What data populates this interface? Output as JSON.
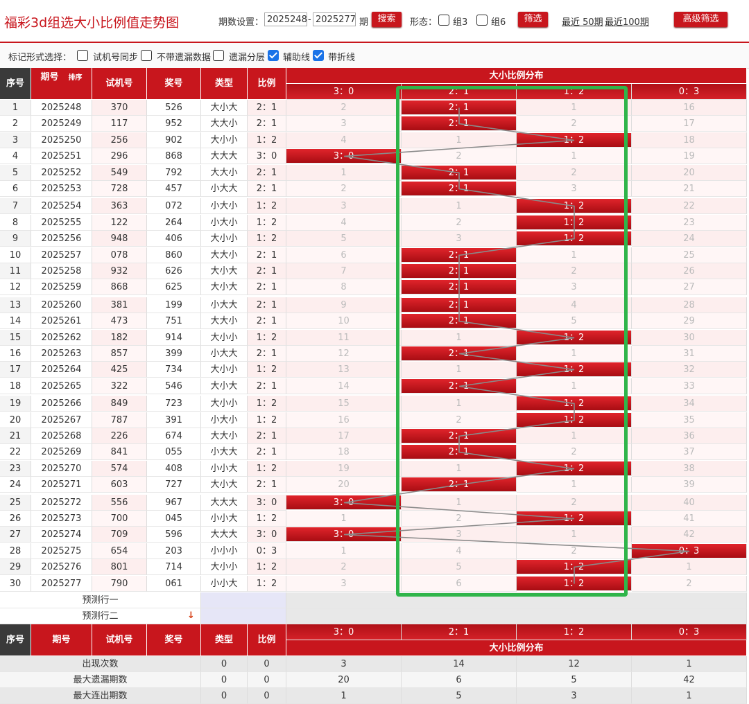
{
  "header": {
    "title": "福彩3d组选大小比例值走势图",
    "period_label": "期数设置：",
    "period_from": "2025248",
    "period_dash": "-",
    "period_to": "2025277",
    "period_unit": "期",
    "search_label": "搜索",
    "form_label": "形态：",
    "group3_label": "组3",
    "group6_label": "组6",
    "filter_label": "筛选",
    "recent50_label": "最近 50期",
    "recent100_label": "最近100期",
    "advanced_label": "高级筛选"
  },
  "mark": {
    "label": "标记形式选择：",
    "options": [
      {
        "label": "试机号同步",
        "checked": false
      },
      {
        "label": "不带遗漏数据",
        "checked": false
      },
      {
        "label": "遗漏分层",
        "checked": false
      },
      {
        "label": "辅助线",
        "checked": true
      },
      {
        "label": "带折线",
        "checked": true
      }
    ]
  },
  "table": {
    "headers": {
      "seq": "序号",
      "period": "期号",
      "sort": "排序",
      "trial": "试机号",
      "draw": "奖号",
      "type": "类型",
      "ratio": "比例",
      "dist": "大小比例分布"
    },
    "dist_cols": [
      "3：0",
      "2：1",
      "1：2",
      "0：3"
    ],
    "rows": [
      {
        "seq": "1",
        "period": "2025248",
        "trial": "370",
        "draw": "526",
        "type": "大小大",
        "ratio": "2：1",
        "hit": 1,
        "miss": [
          "2",
          "",
          "1",
          "16"
        ]
      },
      {
        "seq": "2",
        "period": "2025249",
        "trial": "117",
        "draw": "952",
        "type": "大大小",
        "ratio": "2：1",
        "hit": 1,
        "miss": [
          "3",
          "",
          "2",
          "17"
        ]
      },
      {
        "seq": "3",
        "period": "2025250",
        "trial": "256",
        "draw": "902",
        "type": "大小小",
        "ratio": "1：2",
        "hit": 2,
        "miss": [
          "4",
          "1",
          "",
          "18"
        ]
      },
      {
        "seq": "4",
        "period": "2025251",
        "trial": "296",
        "draw": "868",
        "type": "大大大",
        "ratio": "3：0",
        "hit": 0,
        "miss": [
          "",
          "2",
          "1",
          "19"
        ]
      },
      {
        "seq": "5",
        "period": "2025252",
        "trial": "549",
        "draw": "792",
        "type": "大大小",
        "ratio": "2：1",
        "hit": 1,
        "miss": [
          "1",
          "",
          "2",
          "20"
        ]
      },
      {
        "seq": "6",
        "period": "2025253",
        "trial": "728",
        "draw": "457",
        "type": "小大大",
        "ratio": "2：1",
        "hit": 1,
        "miss": [
          "2",
          "",
          "3",
          "21"
        ]
      },
      {
        "seq": "7",
        "period": "2025254",
        "trial": "363",
        "draw": "072",
        "type": "小大小",
        "ratio": "1：2",
        "hit": 2,
        "miss": [
          "3",
          "1",
          "",
          "22"
        ]
      },
      {
        "seq": "8",
        "period": "2025255",
        "trial": "122",
        "draw": "264",
        "type": "小大小",
        "ratio": "1：2",
        "hit": 2,
        "miss": [
          "4",
          "2",
          "",
          "23"
        ]
      },
      {
        "seq": "9",
        "period": "2025256",
        "trial": "948",
        "draw": "406",
        "type": "大小小",
        "ratio": "1：2",
        "hit": 2,
        "miss": [
          "5",
          "3",
          "",
          "24"
        ]
      },
      {
        "seq": "10",
        "period": "2025257",
        "trial": "078",
        "draw": "860",
        "type": "大大小",
        "ratio": "2：1",
        "hit": 1,
        "miss": [
          "6",
          "",
          "1",
          "25"
        ]
      },
      {
        "seq": "11",
        "period": "2025258",
        "trial": "932",
        "draw": "626",
        "type": "大小大",
        "ratio": "2：1",
        "hit": 1,
        "miss": [
          "7",
          "",
          "2",
          "26"
        ]
      },
      {
        "seq": "12",
        "period": "2025259",
        "trial": "868",
        "draw": "625",
        "type": "大小大",
        "ratio": "2：1",
        "hit": 1,
        "miss": [
          "8",
          "",
          "3",
          "27"
        ]
      },
      {
        "seq": "13",
        "period": "2025260",
        "trial": "381",
        "draw": "199",
        "type": "小大大",
        "ratio": "2：1",
        "hit": 1,
        "miss": [
          "9",
          "",
          "4",
          "28"
        ]
      },
      {
        "seq": "14",
        "period": "2025261",
        "trial": "473",
        "draw": "751",
        "type": "大大小",
        "ratio": "2：1",
        "hit": 1,
        "miss": [
          "10",
          "",
          "5",
          "29"
        ]
      },
      {
        "seq": "15",
        "period": "2025262",
        "trial": "182",
        "draw": "914",
        "type": "大小小",
        "ratio": "1：2",
        "hit": 2,
        "miss": [
          "11",
          "1",
          "",
          "30"
        ]
      },
      {
        "seq": "16",
        "period": "2025263",
        "trial": "857",
        "draw": "399",
        "type": "小大大",
        "ratio": "2：1",
        "hit": 1,
        "miss": [
          "12",
          "",
          "1",
          "31"
        ]
      },
      {
        "seq": "17",
        "period": "2025264",
        "trial": "425",
        "draw": "734",
        "type": "大小小",
        "ratio": "1：2",
        "hit": 2,
        "miss": [
          "13",
          "1",
          "",
          "32"
        ]
      },
      {
        "seq": "18",
        "period": "2025265",
        "trial": "322",
        "draw": "546",
        "type": "大小大",
        "ratio": "2：1",
        "hit": 1,
        "miss": [
          "14",
          "",
          "1",
          "33"
        ]
      },
      {
        "seq": "19",
        "period": "2025266",
        "trial": "849",
        "draw": "723",
        "type": "大小小",
        "ratio": "1：2",
        "hit": 2,
        "miss": [
          "15",
          "1",
          "",
          "34"
        ]
      },
      {
        "seq": "20",
        "period": "2025267",
        "trial": "787",
        "draw": "391",
        "type": "小大小",
        "ratio": "1：2",
        "hit": 2,
        "miss": [
          "16",
          "2",
          "",
          "35"
        ]
      },
      {
        "seq": "21",
        "period": "2025268",
        "trial": "226",
        "draw": "674",
        "type": "大大小",
        "ratio": "2：1",
        "hit": 1,
        "miss": [
          "17",
          "",
          "1",
          "36"
        ]
      },
      {
        "seq": "22",
        "period": "2025269",
        "trial": "841",
        "draw": "055",
        "type": "小大大",
        "ratio": "2：1",
        "hit": 1,
        "miss": [
          "18",
          "",
          "2",
          "37"
        ]
      },
      {
        "seq": "23",
        "period": "2025270",
        "trial": "574",
        "draw": "408",
        "type": "小小大",
        "ratio": "1：2",
        "hit": 2,
        "miss": [
          "19",
          "1",
          "",
          "38"
        ]
      },
      {
        "seq": "24",
        "period": "2025271",
        "trial": "603",
        "draw": "727",
        "type": "大小大",
        "ratio": "2：1",
        "hit": 1,
        "miss": [
          "20",
          "",
          "1",
          "39"
        ]
      },
      {
        "seq": "25",
        "period": "2025272",
        "trial": "556",
        "draw": "967",
        "type": "大大大",
        "ratio": "3：0",
        "hit": 0,
        "miss": [
          "",
          "1",
          "2",
          "40"
        ]
      },
      {
        "seq": "26",
        "period": "2025273",
        "trial": "700",
        "draw": "045",
        "type": "小小大",
        "ratio": "1：2",
        "hit": 2,
        "miss": [
          "1",
          "2",
          "",
          "41"
        ]
      },
      {
        "seq": "27",
        "period": "2025274",
        "trial": "709",
        "draw": "596",
        "type": "大大大",
        "ratio": "3：0",
        "hit": 0,
        "miss": [
          "",
          "3",
          "1",
          "42"
        ]
      },
      {
        "seq": "28",
        "period": "2025275",
        "trial": "654",
        "draw": "203",
        "type": "小小小",
        "ratio": "0：3",
        "hit": 3,
        "miss": [
          "1",
          "4",
          "2",
          ""
        ]
      },
      {
        "seq": "29",
        "period": "2025276",
        "trial": "801",
        "draw": "714",
        "type": "大小小",
        "ratio": "1：2",
        "hit": 2,
        "miss": [
          "2",
          "5",
          "",
          "1"
        ]
      },
      {
        "seq": "30",
        "period": "2025277",
        "trial": "790",
        "draw": "061",
        "type": "小小大",
        "ratio": "1：2",
        "hit": 2,
        "miss": [
          "3",
          "6",
          "",
          "2"
        ]
      }
    ],
    "predict1": "预测行一",
    "predict2": "预测行二",
    "stats": [
      {
        "label": "出现次数",
        "type": "0",
        "ratio": "0",
        "vals": [
          "3",
          "14",
          "12",
          "1"
        ]
      },
      {
        "label": "最大遗漏期数",
        "type": "0",
        "ratio": "0",
        "vals": [
          "20",
          "6",
          "5",
          "42"
        ]
      },
      {
        "label": "最大连出期数",
        "type": "0",
        "ratio": "0",
        "vals": [
          "1",
          "5",
          "3",
          "1"
        ]
      }
    ]
  },
  "colors": {
    "accent": "#c8161d",
    "highlight": "#2fb54a"
  }
}
